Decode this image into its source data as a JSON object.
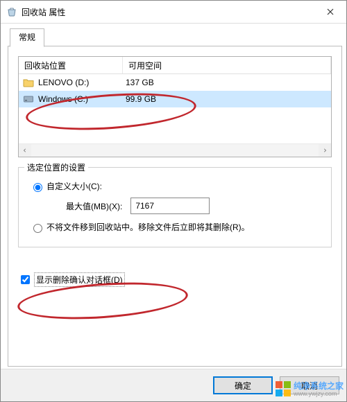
{
  "window": {
    "title": "回收站 属性"
  },
  "tab": {
    "general": "常规"
  },
  "list": {
    "cols": {
      "location": "回收站位置",
      "available": "可用空间"
    },
    "col1_width": 150,
    "rows": [
      {
        "name": "LENOVO (D:)",
        "size": "137 GB",
        "selected": false
      },
      {
        "name": "Windows (C:)",
        "size": "99.9 GB",
        "selected": true
      }
    ]
  },
  "settings": {
    "legend": "选定位置的设置",
    "radio_custom": "自定义大小(C):",
    "max_label": "最大值(MB)(X):",
    "max_value": "7167",
    "radio_nobin": "不将文件移到回收站中。移除文件后立即将其删除(R)。",
    "confirm_label": "显示删除确认对话框(D)"
  },
  "buttons": {
    "ok": "确定",
    "cancel": "取消"
  },
  "watermark": {
    "brand": "纯净系统之家",
    "url": "www.ywjzy.com"
  },
  "colors": {
    "folder": "#f8d26b",
    "disk": "#9db2c4",
    "win1": "#f25022",
    "win2": "#7fba00",
    "win3": "#00a4ef",
    "win4": "#ffb900",
    "annot": "#c1272d"
  }
}
